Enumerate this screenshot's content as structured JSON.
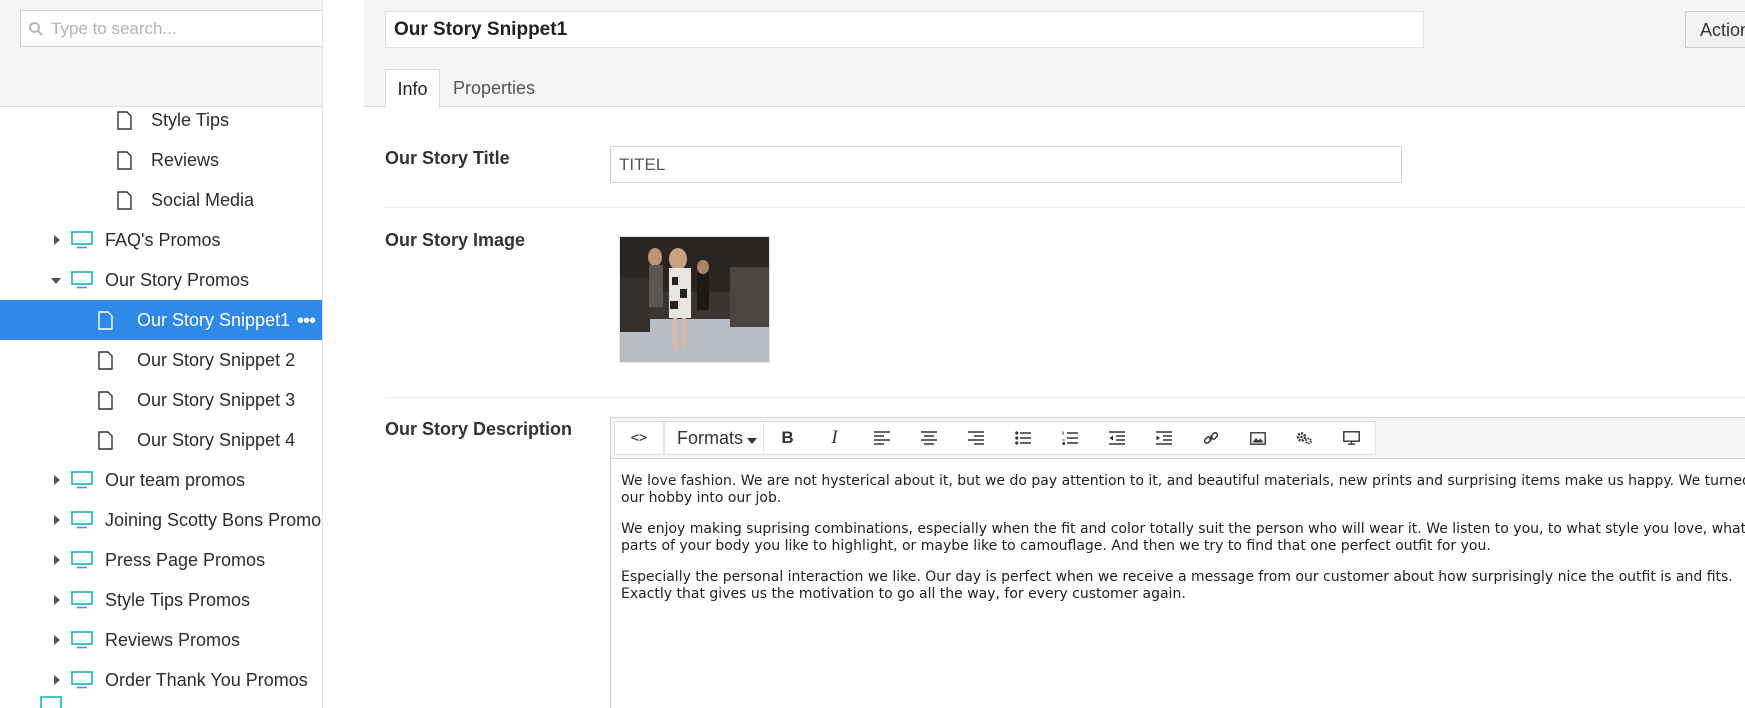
{
  "search": {
    "placeholder": "Type to search..."
  },
  "tree": {
    "items": [
      {
        "label": "Style Tips",
        "type": "page",
        "level": 2
      },
      {
        "label": "Reviews",
        "type": "page",
        "level": 2
      },
      {
        "label": "Social Media",
        "type": "page",
        "level": 2
      },
      {
        "label": "FAQ's Promos",
        "type": "folder",
        "level": 1,
        "expanded": false
      },
      {
        "label": "Our Story Promos",
        "type": "folder",
        "level": 1,
        "expanded": true
      },
      {
        "label": "Our Story Snippet1",
        "type": "page",
        "level": 2,
        "selected": true
      },
      {
        "label": "Our Story Snippet 2",
        "type": "page",
        "level": 2
      },
      {
        "label": "Our Story Snippet 3",
        "type": "page",
        "level": 2
      },
      {
        "label": "Our Story Snippet 4",
        "type": "page",
        "level": 2
      },
      {
        "label": "Our team promos",
        "type": "folder",
        "level": 1,
        "expanded": false
      },
      {
        "label": "Joining Scotty Bons Promos",
        "type": "folder",
        "level": 1,
        "expanded": false
      },
      {
        "label": "Press Page Promos",
        "type": "folder",
        "level": 1,
        "expanded": false
      },
      {
        "label": "Style Tips Promos",
        "type": "folder",
        "level": 1,
        "expanded": false
      },
      {
        "label": "Reviews Promos",
        "type": "folder",
        "level": 1,
        "expanded": false
      },
      {
        "label": "Order Thank You Promos",
        "type": "folder",
        "level": 1,
        "expanded": false
      }
    ],
    "selected_more": "•••"
  },
  "header": {
    "node_name": "Our Story Snippet1",
    "actions_label": "Actions",
    "tabs": [
      {
        "label": "Info"
      },
      {
        "label": "Properties"
      }
    ]
  },
  "properties": {
    "title_label": "Our Story Title",
    "title_value": "TITEL",
    "image_label": "Our Story Image",
    "description_label": "Our Story Description"
  },
  "rte": {
    "formats_label": "Formats",
    "toolbar_icons": [
      "code-icon",
      "formats-dropdown",
      "bold-icon",
      "italic-icon",
      "align-left-icon",
      "align-center-icon",
      "align-right-icon",
      "bullet-list-icon",
      "numbered-list-icon",
      "outdent-icon",
      "indent-icon",
      "link-icon",
      "image-icon",
      "macro-icon",
      "embed-icon"
    ],
    "bold_glyph": "B",
    "italic_glyph": "I",
    "code_glyph": "<>",
    "paragraphs": [
      "We love fashion. We are not hysterical about it, but we do pay attention to it, and beautiful materials, new prints and surprising items make us happy. We turned our hobby into our job.",
      "We enjoy making suprising combinations, especially when the fit and color totally suit the person who will wear it. We listen to you, to what style you love, what parts of your body you like to highlight, or maybe like to camouflage. And then we try to find that one perfect outfit for you.",
      "Especially the personal interaction we like. Our day is perfect when we receive a message from our customer about how surprisingly nice the outfit is and fits. Exactly that gives us the motivation to go all the way, for every customer again."
    ]
  },
  "colors": {
    "selected_bg": "#2e89e8",
    "folder_icon": "#18b3c6"
  }
}
